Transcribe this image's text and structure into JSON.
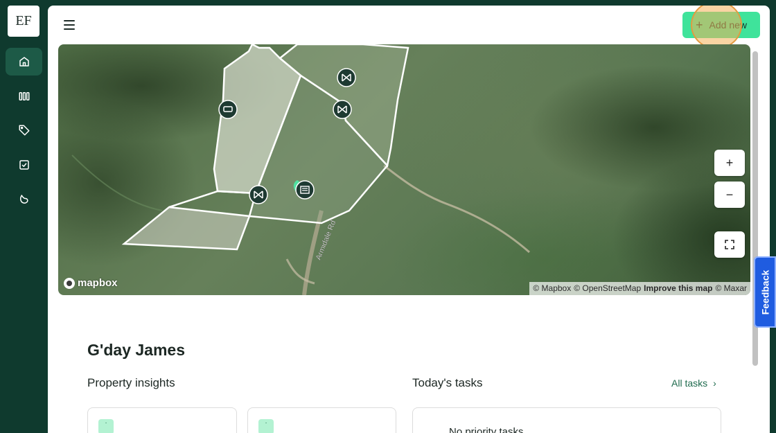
{
  "app": {
    "logo_text": "EF"
  },
  "sidebar": {
    "items": [
      {
        "name": "home",
        "icon": "home-icon",
        "active": true
      },
      {
        "name": "paddocks",
        "icon": "paddocks-icon",
        "active": false
      },
      {
        "name": "tags",
        "icon": "tag-icon",
        "active": false
      },
      {
        "name": "tasks",
        "icon": "checkbox-icon",
        "active": false
      },
      {
        "name": "livestock",
        "icon": "livestock-icon",
        "active": false
      }
    ]
  },
  "header": {
    "menu_icon": "hamburger-icon",
    "add_button": {
      "icon": "plus",
      "label": "Add new"
    }
  },
  "map": {
    "controls": {
      "zoom_in": "+",
      "zoom_out": "−",
      "fullscreen": "⛶"
    },
    "road_label": "Armidale Rd",
    "logo_text": "mapbox",
    "attribution": {
      "mapbox": "© Mapbox",
      "osm": "© OpenStreetMap",
      "improve": "Improve this map",
      "maxar": "© Maxar"
    },
    "colors": {
      "boundary": "#ffffff",
      "marker_bg": "#1e3a32",
      "marker_active": "#4fe0a0"
    }
  },
  "content": {
    "greeting": "G'day James",
    "insights_title": "Property insights",
    "tasks_title": "Today's tasks",
    "all_tasks_label": "All tasks",
    "all_tasks_chevron": "›",
    "cards": [
      {
        "chip": "·"
      },
      {
        "chip": "·"
      }
    ],
    "empty_tasks": "No priority tasks"
  },
  "feedback": {
    "label": "Feedback"
  },
  "colors": {
    "sidebar_bg": "#0f3a2e",
    "accent": "#3fe39b",
    "feedback": "#1f5ce0"
  }
}
